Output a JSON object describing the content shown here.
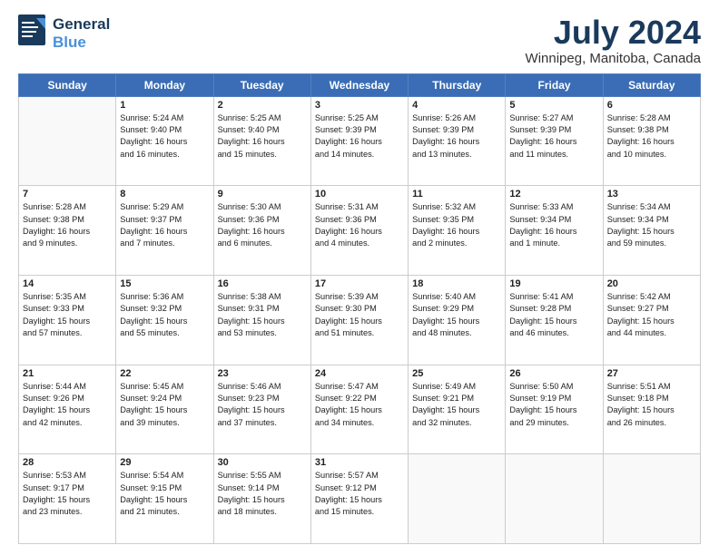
{
  "header": {
    "logo_line1": "General",
    "logo_line2": "Blue",
    "month": "July 2024",
    "location": "Winnipeg, Manitoba, Canada"
  },
  "weekdays": [
    "Sunday",
    "Monday",
    "Tuesday",
    "Wednesday",
    "Thursday",
    "Friday",
    "Saturday"
  ],
  "weeks": [
    [
      {
        "day": "",
        "info": ""
      },
      {
        "day": "1",
        "info": "Sunrise: 5:24 AM\nSunset: 9:40 PM\nDaylight: 16 hours\nand 16 minutes."
      },
      {
        "day": "2",
        "info": "Sunrise: 5:25 AM\nSunset: 9:40 PM\nDaylight: 16 hours\nand 15 minutes."
      },
      {
        "day": "3",
        "info": "Sunrise: 5:25 AM\nSunset: 9:39 PM\nDaylight: 16 hours\nand 14 minutes."
      },
      {
        "day": "4",
        "info": "Sunrise: 5:26 AM\nSunset: 9:39 PM\nDaylight: 16 hours\nand 13 minutes."
      },
      {
        "day": "5",
        "info": "Sunrise: 5:27 AM\nSunset: 9:39 PM\nDaylight: 16 hours\nand 11 minutes."
      },
      {
        "day": "6",
        "info": "Sunrise: 5:28 AM\nSunset: 9:38 PM\nDaylight: 16 hours\nand 10 minutes."
      }
    ],
    [
      {
        "day": "7",
        "info": "Sunrise: 5:28 AM\nSunset: 9:38 PM\nDaylight: 16 hours\nand 9 minutes."
      },
      {
        "day": "8",
        "info": "Sunrise: 5:29 AM\nSunset: 9:37 PM\nDaylight: 16 hours\nand 7 minutes."
      },
      {
        "day": "9",
        "info": "Sunrise: 5:30 AM\nSunset: 9:36 PM\nDaylight: 16 hours\nand 6 minutes."
      },
      {
        "day": "10",
        "info": "Sunrise: 5:31 AM\nSunset: 9:36 PM\nDaylight: 16 hours\nand 4 minutes."
      },
      {
        "day": "11",
        "info": "Sunrise: 5:32 AM\nSunset: 9:35 PM\nDaylight: 16 hours\nand 2 minutes."
      },
      {
        "day": "12",
        "info": "Sunrise: 5:33 AM\nSunset: 9:34 PM\nDaylight: 16 hours\nand 1 minute."
      },
      {
        "day": "13",
        "info": "Sunrise: 5:34 AM\nSunset: 9:34 PM\nDaylight: 15 hours\nand 59 minutes."
      }
    ],
    [
      {
        "day": "14",
        "info": "Sunrise: 5:35 AM\nSunset: 9:33 PM\nDaylight: 15 hours\nand 57 minutes."
      },
      {
        "day": "15",
        "info": "Sunrise: 5:36 AM\nSunset: 9:32 PM\nDaylight: 15 hours\nand 55 minutes."
      },
      {
        "day": "16",
        "info": "Sunrise: 5:38 AM\nSunset: 9:31 PM\nDaylight: 15 hours\nand 53 minutes."
      },
      {
        "day": "17",
        "info": "Sunrise: 5:39 AM\nSunset: 9:30 PM\nDaylight: 15 hours\nand 51 minutes."
      },
      {
        "day": "18",
        "info": "Sunrise: 5:40 AM\nSunset: 9:29 PM\nDaylight: 15 hours\nand 48 minutes."
      },
      {
        "day": "19",
        "info": "Sunrise: 5:41 AM\nSunset: 9:28 PM\nDaylight: 15 hours\nand 46 minutes."
      },
      {
        "day": "20",
        "info": "Sunrise: 5:42 AM\nSunset: 9:27 PM\nDaylight: 15 hours\nand 44 minutes."
      }
    ],
    [
      {
        "day": "21",
        "info": "Sunrise: 5:44 AM\nSunset: 9:26 PM\nDaylight: 15 hours\nand 42 minutes."
      },
      {
        "day": "22",
        "info": "Sunrise: 5:45 AM\nSunset: 9:24 PM\nDaylight: 15 hours\nand 39 minutes."
      },
      {
        "day": "23",
        "info": "Sunrise: 5:46 AM\nSunset: 9:23 PM\nDaylight: 15 hours\nand 37 minutes."
      },
      {
        "day": "24",
        "info": "Sunrise: 5:47 AM\nSunset: 9:22 PM\nDaylight: 15 hours\nand 34 minutes."
      },
      {
        "day": "25",
        "info": "Sunrise: 5:49 AM\nSunset: 9:21 PM\nDaylight: 15 hours\nand 32 minutes."
      },
      {
        "day": "26",
        "info": "Sunrise: 5:50 AM\nSunset: 9:19 PM\nDaylight: 15 hours\nand 29 minutes."
      },
      {
        "day": "27",
        "info": "Sunrise: 5:51 AM\nSunset: 9:18 PM\nDaylight: 15 hours\nand 26 minutes."
      }
    ],
    [
      {
        "day": "28",
        "info": "Sunrise: 5:53 AM\nSunset: 9:17 PM\nDaylight: 15 hours\nand 23 minutes."
      },
      {
        "day": "29",
        "info": "Sunrise: 5:54 AM\nSunset: 9:15 PM\nDaylight: 15 hours\nand 21 minutes."
      },
      {
        "day": "30",
        "info": "Sunrise: 5:55 AM\nSunset: 9:14 PM\nDaylight: 15 hours\nand 18 minutes."
      },
      {
        "day": "31",
        "info": "Sunrise: 5:57 AM\nSunset: 9:12 PM\nDaylight: 15 hours\nand 15 minutes."
      },
      {
        "day": "",
        "info": ""
      },
      {
        "day": "",
        "info": ""
      },
      {
        "day": "",
        "info": ""
      }
    ]
  ]
}
